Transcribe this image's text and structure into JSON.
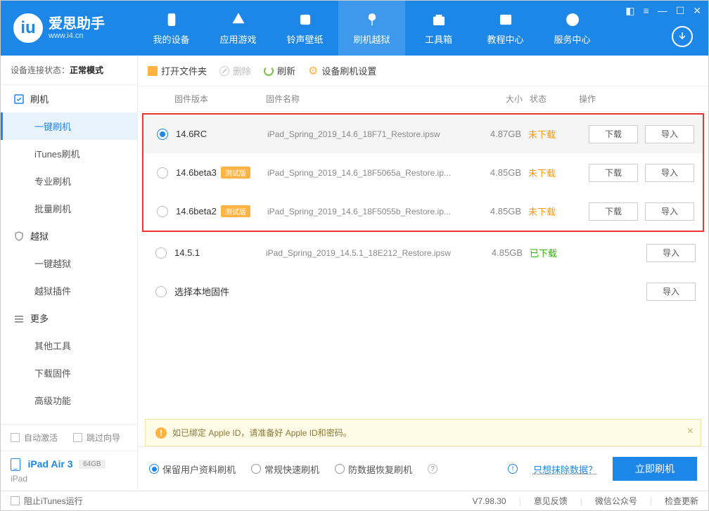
{
  "logo": {
    "title": "爱思助手",
    "url": "www.i4.cn"
  },
  "nav": [
    "我的设备",
    "应用游戏",
    "铃声壁纸",
    "刷机越狱",
    "工具箱",
    "教程中心",
    "服务中心"
  ],
  "activeNav": 3,
  "conn": {
    "label": "设备连接状态：",
    "value": "正常模式"
  },
  "sidebar": {
    "groups": [
      {
        "title": "刷机",
        "items": [
          "一键刷机",
          "iTunes刷机",
          "专业刷机",
          "批量刷机"
        ],
        "active": 0
      },
      {
        "title": "越狱",
        "items": [
          "一键越狱",
          "越狱插件"
        ]
      },
      {
        "title": "更多",
        "items": [
          "其他工具",
          "下载固件",
          "高级功能"
        ]
      }
    ],
    "opts": {
      "autoActivate": "自动激活",
      "skipGuide": "跳过向导"
    }
  },
  "device": {
    "name": "iPad Air 3",
    "storage": "64GB",
    "type": "iPad"
  },
  "toolbar": {
    "open": "打开文件夹",
    "delete": "删除",
    "refresh": "刷新",
    "settings": "设备刷机设置"
  },
  "columns": {
    "version": "固件版本",
    "name": "固件名称",
    "size": "大小",
    "status": "状态",
    "ops": "操作"
  },
  "rows": [
    {
      "ver": "14.6RC",
      "beta": false,
      "name": "iPad_Spring_2019_14.6_18F71_Restore.ipsw",
      "size": "4.87GB",
      "status": "未下载",
      "sel": true,
      "boxed": true
    },
    {
      "ver": "14.6beta3",
      "beta": true,
      "name": "iPad_Spring_2019_14.6_18F5065a_Restore.ip...",
      "size": "4.85GB",
      "status": "未下载",
      "sel": false,
      "boxed": true
    },
    {
      "ver": "14.6beta2",
      "beta": true,
      "name": "iPad_Spring_2019_14.6_18F5055b_Restore.ip...",
      "size": "4.85GB",
      "status": "未下载",
      "sel": false,
      "boxed": true
    },
    {
      "ver": "14.5.1",
      "beta": false,
      "name": "iPad_Spring_2019_14.5.1_18E212_Restore.ipsw",
      "size": "4.85GB",
      "status": "已下载",
      "sel": false,
      "boxed": false
    }
  ],
  "localRow": "选择本地固件",
  "betaLabel": "测试版",
  "opsLabels": {
    "download": "下载",
    "import": "导入"
  },
  "notice": "如已绑定 Apple ID，请准备好 Apple ID和密码。",
  "modes": [
    "保留用户资料刷机",
    "常规快速刷机",
    "防数据恢复刷机"
  ],
  "modesActive": 0,
  "eraseLink": "只想抹除数据？",
  "flashBtn": "立即刷机",
  "footer": {
    "block": "阻止iTunes运行",
    "version": "V7.98.30",
    "feedback": "意见反馈",
    "wechat": "微信公众号",
    "update": "检查更新"
  }
}
